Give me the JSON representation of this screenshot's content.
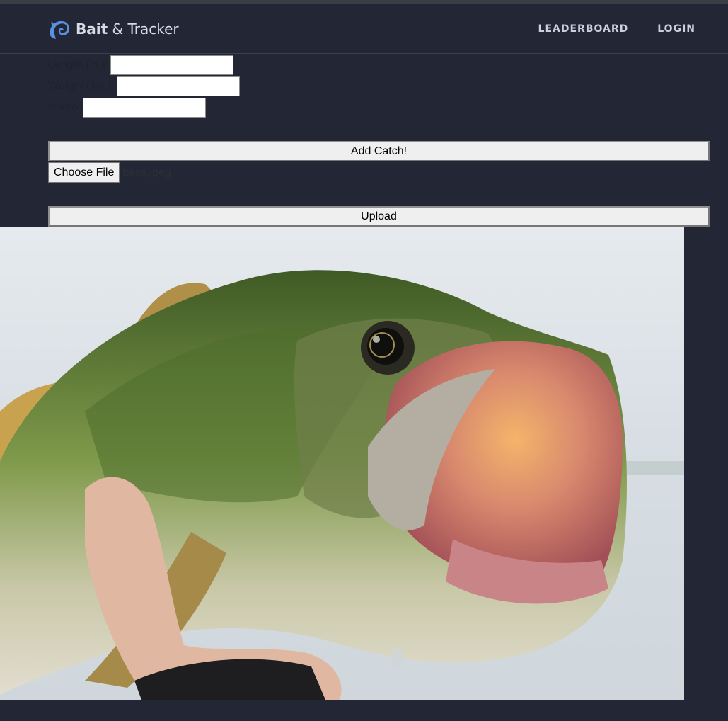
{
  "brand": {
    "bold": "Bait",
    "rest": " & Tracker",
    "icon": "fish-logo-icon"
  },
  "nav": {
    "leaderboard": "LEADERBOARD",
    "login": "LOGIN"
  },
  "form": {
    "length_label": "Length (in.):",
    "length_value": "",
    "weight_label": "Weight (lbs.):",
    "weight_value": "",
    "photo_label": "Photo:",
    "photo_value": "",
    "add_button": "Add Catch!"
  },
  "upload": {
    "choose_label": "Choose File",
    "file_name": "bass.jpeg",
    "upload_button": "Upload"
  },
  "colors": {
    "background": "#232735",
    "nav_text": "#c9d0de",
    "brand_icon": "#5b8fe0",
    "button_bg": "#efefef"
  }
}
